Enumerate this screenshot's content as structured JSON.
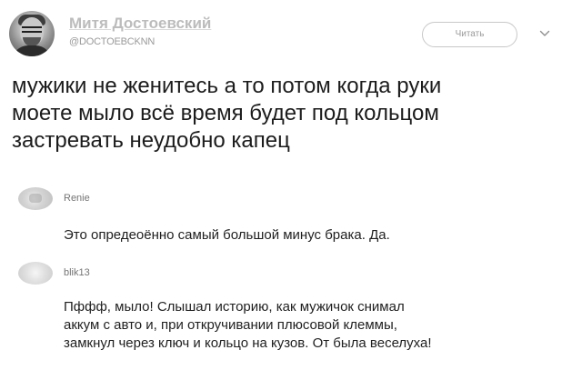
{
  "tweet": {
    "author_name": "Митя Достоевский",
    "author_handle": "@DOCTOEBCKNN",
    "follow_label": "Читать",
    "text": "мужики не женитесь а то потом когда руки\nмоете мыло всё время будет под кольцом\nзастревать неудобно капец"
  },
  "replies": [
    {
      "author": "Renie",
      "text": "Это опредеоённо самый большой минус брака. Да."
    },
    {
      "author": "blik13",
      "text": "Пффф, мыло! Слышал историю, как мужичок снимал\nаккум с авто и, при откручивании плюсовой клеммы,\nзамкнул через ключ и кольцо на кузов. От была веселуха!"
    }
  ],
  "icons": {
    "caret": "chevron-down-icon"
  },
  "colors": {
    "author_name": "#bcbcbc",
    "secondary_text": "#9a9a9a",
    "button_border": "#c8c8c8"
  }
}
